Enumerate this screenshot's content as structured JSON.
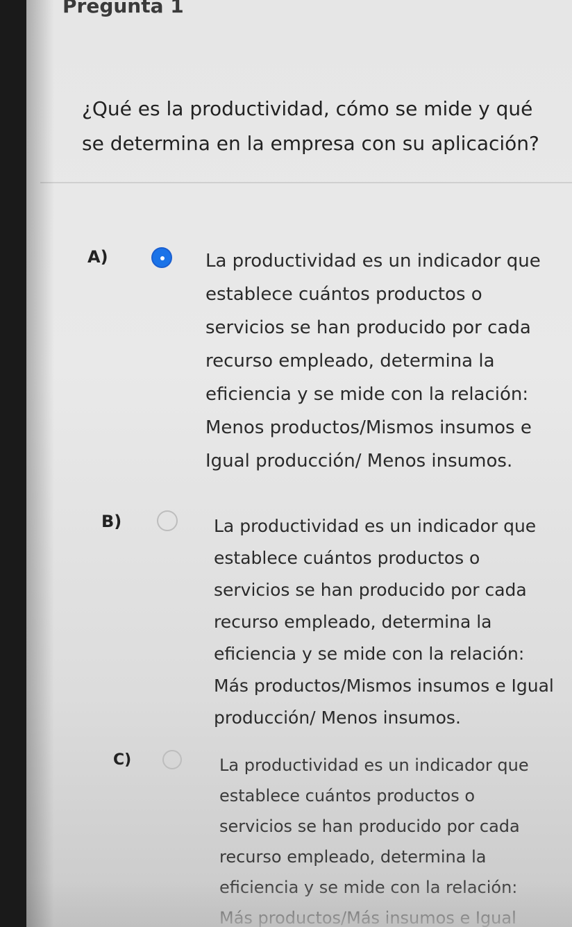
{
  "question": {
    "label": "Pregunta 1",
    "text": "¿Qué es la productividad, cómo se mide y qué se determina en la empresa con su aplicación?"
  },
  "options": [
    {
      "letter": "A)",
      "selected": true,
      "text": "La productividad es un indicador que establece cuántos productos o servicios se han producido por cada recurso empleado, determina la eficiencia y se mide con la relación: Menos productos/Mismos insumos e Igual producción/ Menos insumos."
    },
    {
      "letter": "B)",
      "selected": false,
      "text": "La productividad es un indicador que establece cuántos productos o servicios se han producido por cada recurso empleado, determina la eficiencia y se mide con la relación: Más productos/Mismos insumos e Igual producción/ Menos insumos."
    },
    {
      "letter": "C)",
      "selected": false,
      "text": "La productividad es un indicador que establece cuántos productos o servicios se han producido por cada recurso empleado, determina la eficiencia y se mide con la relación: Más productos/Más insumos e Igual"
    }
  ],
  "colors": {
    "accent": "#1a73e8"
  }
}
